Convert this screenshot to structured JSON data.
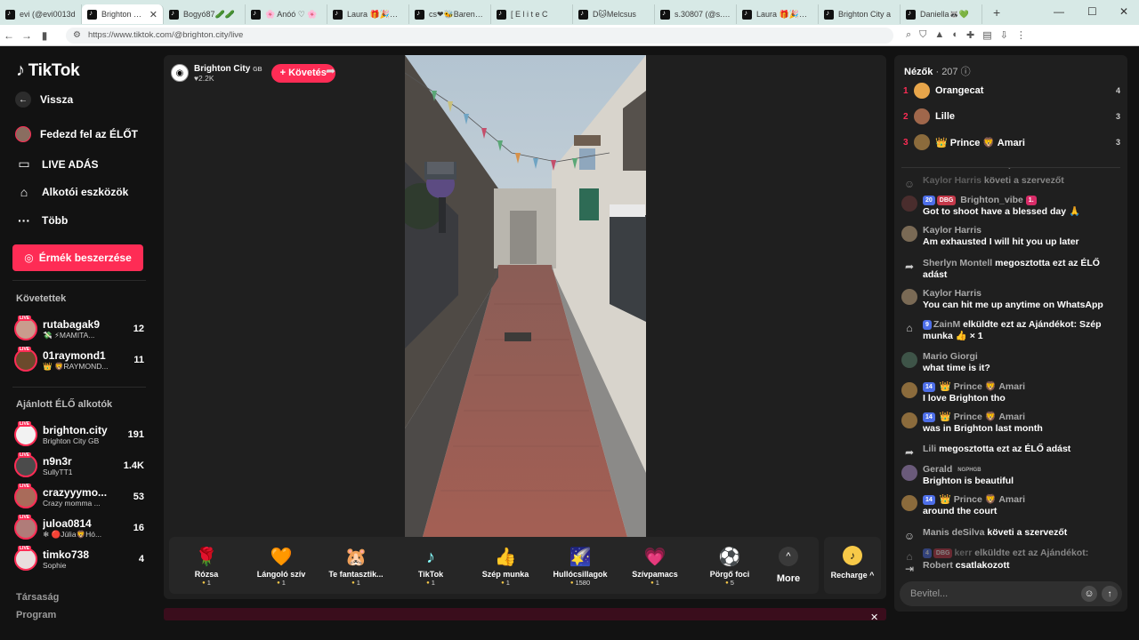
{
  "browser": {
    "tabs": [
      {
        "title": "evi (@evi0013d",
        "active": false
      },
      {
        "title": "Brighton City",
        "active": true
      },
      {
        "title": "Bogyó87🥒🥒",
        "active": false
      },
      {
        "title": "🌸 Anóó ♡ 🌸",
        "active": false
      },
      {
        "title": "Laura 🎁🎉🎈 (©",
        "active": false
      },
      {
        "title": "cs❤🐝Barenka🌷",
        "active": false
      },
      {
        "title": "[ E l i t e C",
        "active": false
      },
      {
        "title": "D🐱Melcsus",
        "active": false
      },
      {
        "title": "s.30807 (@s.30",
        "active": false
      },
      {
        "title": "Laura 🎁🎉🎈 (©",
        "active": false
      },
      {
        "title": "Brighton City a",
        "active": false
      },
      {
        "title": "Daniella🦝💚",
        "active": false
      }
    ],
    "new_tab": "+",
    "url": "https://www.tiktok.com/@brighton.city/live"
  },
  "sidebar": {
    "logo": "TikTok",
    "back": "Vissza",
    "nav": [
      {
        "label": "Fedezd fel az ÉLŐT",
        "icon": "avatar"
      },
      {
        "label": "LIVE ADÁS",
        "icon": "camera-icon"
      },
      {
        "label": "Alkotói eszközök",
        "icon": "creator-tools-icon"
      },
      {
        "label": "Több",
        "icon": "more-icon"
      }
    ],
    "coins_button": "Érmék beszerzése",
    "following_title": "Követettek",
    "following": [
      {
        "name": "rutabagak9",
        "sub": "💸 ⚡MAMITA...",
        "count": "12"
      },
      {
        "name": "01raymond1",
        "sub": "👑 🦁RAYMOND...",
        "count": "11"
      }
    ],
    "recommended_title": "Ajánlott ÉLŐ alkotók",
    "recommended": [
      {
        "name": "brighton.city",
        "sub": "Brighton City GB",
        "count": "191"
      },
      {
        "name": "n9n3r",
        "sub": "SullyTT1",
        "count": "1.4K"
      },
      {
        "name": "crazyyymo...",
        "sub": "Crazy momma ...",
        "count": "53"
      },
      {
        "name": "juloa0814",
        "sub": "❄ 🔴Júlia🦁Hó...",
        "count": "16"
      },
      {
        "name": "timko738",
        "sub": "Sophie",
        "count": "4"
      }
    ],
    "footer": [
      "Társaság",
      "Program"
    ]
  },
  "stage": {
    "host_name": "Brighton City",
    "host_flag": "GB",
    "host_likes": "♥2.2K",
    "follow": "+ Követés",
    "gifts": [
      {
        "name": "Rózsa",
        "price": "1",
        "icon": "🌹"
      },
      {
        "name": "Lángoló szív",
        "price": "1",
        "icon": "❤️‍🔥"
      },
      {
        "name": "Te fantasztik...",
        "price": "1",
        "icon": "🐹"
      },
      {
        "name": "TikTok",
        "price": "1",
        "icon": "♪"
      },
      {
        "name": "Szép munka",
        "price": "1",
        "icon": "👍"
      },
      {
        "name": "Hullócsillagok",
        "price": "1580",
        "icon": "🌠"
      },
      {
        "name": "Szívpamacs",
        "price": "1",
        "icon": "💗"
      },
      {
        "name": "Pörgő foci",
        "price": "5",
        "icon": "⚽"
      }
    ],
    "more": "More",
    "recharge": "Recharge ^"
  },
  "chat": {
    "viewers_label": "Nézők",
    "viewers_count": "· 207",
    "top_viewers": [
      {
        "rank": "1",
        "name": "Orangecat",
        "score": "4",
        "color": "#e7a54a"
      },
      {
        "rank": "2",
        "name": "Lille",
        "score": "3",
        "color": "#a0674b"
      },
      {
        "rank": "3",
        "name": "👑 Prince 🦁 Amari",
        "score": "3",
        "color": "#8b6b3c"
      }
    ],
    "messages": [
      {
        "user": "Kaylor Harris",
        "text": "követi a szervezőt",
        "kind": "system",
        "faded": true
      },
      {
        "user": "Brighton_vibe",
        "badges": [
          "20",
          "DBG",
          "1."
        ],
        "text": "Got to shoot have a blessed day 🙏",
        "kind": "chat"
      },
      {
        "user": "Kaylor Harris",
        "text": "Am exhausted I will hit you up later",
        "kind": "chat"
      },
      {
        "user": "Sherlyn Montell",
        "text": "megosztotta ezt az ÉLŐ adást",
        "kind": "share"
      },
      {
        "user": "Kaylor Harris",
        "text": "You can hit me up anytime on WhatsApp",
        "kind": "chat"
      },
      {
        "user": "ZainM",
        "badges": [
          "9"
        ],
        "text": "elküldte ezt az Ajándékot: Szép munka 👍 × 1",
        "kind": "gift"
      },
      {
        "user": "Mario Giorgi",
        "text": "what time is it?",
        "kind": "chat"
      },
      {
        "user": "👑 Prince 🦁 Amari",
        "badges": [
          "14"
        ],
        "text": "I love Brighton tho",
        "kind": "chat"
      },
      {
        "user": "👑 Prince 🦁 Amari",
        "badges": [
          "14"
        ],
        "text": "was in Brighton last month",
        "kind": "chat"
      },
      {
        "user": "Lili",
        "text": "megosztotta ezt az ÉLŐ adást",
        "kind": "share"
      },
      {
        "user": "Gerald",
        "tag": "NGPHGB",
        "text": "Brighton is beautiful",
        "kind": "chat"
      },
      {
        "user": "👑 Prince 🦁 Amari",
        "badges": [
          "14"
        ],
        "text": "around the court",
        "kind": "chat"
      },
      {
        "user": "Manis deSilva",
        "text": "követi a szervezőt",
        "kind": "follow"
      },
      {
        "user": "kerr",
        "badges": [
          "4",
          "DBG"
        ],
        "text": "elküldte ezt az Ajándékot:",
        "kind": "gift",
        "faded": true
      },
      {
        "user": "Robert",
        "text": "csatlakozott",
        "kind": "join"
      }
    ],
    "input_placeholder": "Bevitel..."
  }
}
